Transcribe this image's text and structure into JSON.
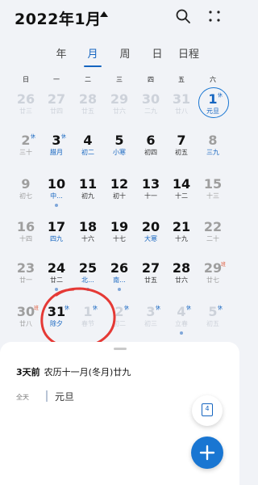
{
  "header": {
    "title": "2022年1月"
  },
  "tabs": [
    "年",
    "月",
    "周",
    "日",
    "日程"
  ],
  "weekdays": [
    "日",
    "一",
    "二",
    "三",
    "四",
    "五",
    "六"
  ],
  "weeks": [
    [
      {
        "day": "26",
        "lunar": "廿三",
        "state": "other"
      },
      {
        "day": "27",
        "lunar": "廿四",
        "state": "other"
      },
      {
        "day": "28",
        "lunar": "廿五",
        "state": "other"
      },
      {
        "day": "29",
        "lunar": "廿六",
        "state": "other"
      },
      {
        "day": "30",
        "lunar": "二九",
        "state": "other"
      },
      {
        "day": "31",
        "lunar": "廿八",
        "state": "other"
      },
      {
        "day": "1",
        "lunar": "元旦",
        "state": "today",
        "tag": "休"
      }
    ],
    [
      {
        "day": "2",
        "lunar": "三十",
        "state": "weekend",
        "tag": "休"
      },
      {
        "day": "3",
        "lunar": "腊月",
        "state": "normal",
        "tag": "休",
        "lunarBlue": true
      },
      {
        "day": "4",
        "lunar": "初二",
        "state": "normal",
        "lunarBlue": true
      },
      {
        "day": "5",
        "lunar": "小寒",
        "state": "normal",
        "lunarBlue": true
      },
      {
        "day": "6",
        "lunar": "初四",
        "state": "normal"
      },
      {
        "day": "7",
        "lunar": "初五",
        "state": "normal"
      },
      {
        "day": "8",
        "lunar": "三九",
        "state": "weekend",
        "lunarBlue": true
      }
    ],
    [
      {
        "day": "9",
        "lunar": "初七",
        "state": "weekend"
      },
      {
        "day": "10",
        "lunar": "中...",
        "state": "normal",
        "lunarBlue": true,
        "dot": true
      },
      {
        "day": "11",
        "lunar": "初九",
        "state": "normal"
      },
      {
        "day": "12",
        "lunar": "初十",
        "state": "normal"
      },
      {
        "day": "13",
        "lunar": "十一",
        "state": "normal"
      },
      {
        "day": "14",
        "lunar": "十二",
        "state": "normal"
      },
      {
        "day": "15",
        "lunar": "十三",
        "state": "weekend"
      }
    ],
    [
      {
        "day": "16",
        "lunar": "十四",
        "state": "weekend"
      },
      {
        "day": "17",
        "lunar": "四九",
        "state": "normal",
        "lunarBlue": true
      },
      {
        "day": "18",
        "lunar": "十六",
        "state": "normal"
      },
      {
        "day": "19",
        "lunar": "十七",
        "state": "normal"
      },
      {
        "day": "20",
        "lunar": "大寒",
        "state": "normal",
        "lunarBlue": true
      },
      {
        "day": "21",
        "lunar": "十九",
        "state": "normal"
      },
      {
        "day": "22",
        "lunar": "二十",
        "state": "weekend"
      }
    ],
    [
      {
        "day": "23",
        "lunar": "廿一",
        "state": "weekend"
      },
      {
        "day": "24",
        "lunar": "廿二",
        "state": "normal",
        "dot": true
      },
      {
        "day": "25",
        "lunar": "北...",
        "state": "normal",
        "lunarBlue": true,
        "dot": true
      },
      {
        "day": "26",
        "lunar": "南...",
        "state": "normal",
        "lunarBlue": true,
        "dot": true
      },
      {
        "day": "27",
        "lunar": "廿五",
        "state": "normal"
      },
      {
        "day": "28",
        "lunar": "廿六",
        "state": "normal"
      },
      {
        "day": "29",
        "lunar": "廿七",
        "state": "weekend",
        "tag": "班",
        "tagRed": true
      }
    ],
    [
      {
        "day": "30",
        "lunar": "廿八",
        "state": "weekend",
        "tag": "班",
        "tagRed": true
      },
      {
        "day": "31",
        "lunar": "除夕",
        "state": "normal",
        "tag": "休",
        "lunarBlue": true
      },
      {
        "day": "1",
        "lunar": "春节",
        "state": "other",
        "tag": "休"
      },
      {
        "day": "2",
        "lunar": "初二",
        "state": "other",
        "tag": "休"
      },
      {
        "day": "3",
        "lunar": "初三",
        "state": "other",
        "tag": "休"
      },
      {
        "day": "4",
        "lunar": "立春",
        "state": "other",
        "tag": "休",
        "dot": true
      },
      {
        "day": "5",
        "lunar": "初五",
        "state": "other",
        "tag": "休"
      }
    ]
  ],
  "sheet": {
    "days_ago": "3天前",
    "lunar_date": "农历十一月(冬月)廿九",
    "allday_label": "全天",
    "event_title": "元旦"
  },
  "fab": {
    "today_number": "4"
  },
  "colors": {
    "accent": "#1976d2",
    "holiday_tag": "#1565c0",
    "work_tag": "#e05a3a",
    "annotation": "#e53935"
  }
}
